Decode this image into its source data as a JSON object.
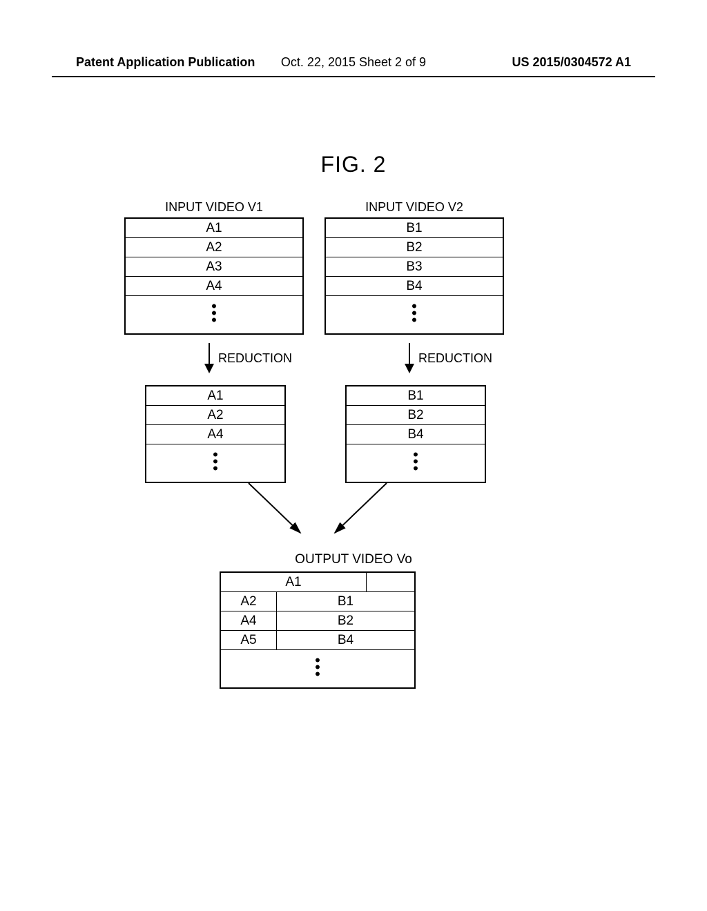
{
  "header": {
    "left": "Patent Application Publication",
    "center": "Oct. 22, 2015  Sheet 2 of 9",
    "right": "US 2015/0304572 A1"
  },
  "figure_title": "FIG. 2",
  "input_v1": {
    "label": "INPUT VIDEO V1",
    "frames": [
      "A1",
      "A2",
      "A3",
      "A4"
    ]
  },
  "input_v2": {
    "label": "INPUT VIDEO V2",
    "frames": [
      "B1",
      "B2",
      "B3",
      "B4"
    ]
  },
  "reduction_label": "REDUCTION",
  "reduced_v1": {
    "frames": [
      "A1",
      "A2",
      "A4"
    ]
  },
  "reduced_v2": {
    "frames": [
      "B1",
      "B2",
      "B4"
    ]
  },
  "output": {
    "label": "OUTPUT VIDEO Vo",
    "top_row": "A1",
    "rows": [
      {
        "a": "A2",
        "b": "B1"
      },
      {
        "a": "A4",
        "b": "B2"
      },
      {
        "a": "A5",
        "b": "B4"
      }
    ]
  }
}
